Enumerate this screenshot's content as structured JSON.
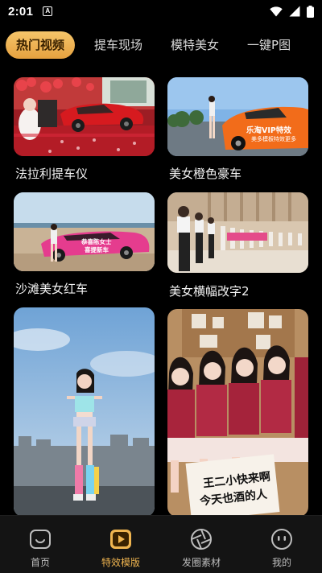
{
  "status_bar": {
    "time": "2:01",
    "app_icon_letter": "A"
  },
  "tabs": [
    {
      "label": "热门视频",
      "active": true
    },
    {
      "label": "提车现场",
      "active": false
    },
    {
      "label": "模特美女",
      "active": false
    },
    {
      "label": "一键P图",
      "active": false
    }
  ],
  "cards": [
    {
      "title": "法拉利提车仪"
    },
    {
      "title": "美女橙色豪车",
      "overlay_text": [
        "乐淘VIP特效",
        "美多模板特效更多"
      ]
    },
    {
      "title": "沙滩美女红车",
      "overlay_text": [
        "恭喜陈女士",
        "喜提新车"
      ]
    },
    {
      "title": "美女横幅改字2"
    },
    {
      "title": ""
    },
    {
      "title": "",
      "overlay_text": [
        "王二小快来啊",
        "今天也酒的人"
      ]
    }
  ],
  "bottom_nav": [
    {
      "label": "首页",
      "icon": "home-icon",
      "active": false
    },
    {
      "label": "特效模版",
      "icon": "play-icon",
      "active": true
    },
    {
      "label": "发圈素材",
      "icon": "aperture-icon",
      "active": false
    },
    {
      "label": "我的",
      "icon": "profile-icon",
      "active": false
    }
  ],
  "colors": {
    "accent": "#F0B550",
    "background": "#000000",
    "tabbar": "#141414"
  }
}
